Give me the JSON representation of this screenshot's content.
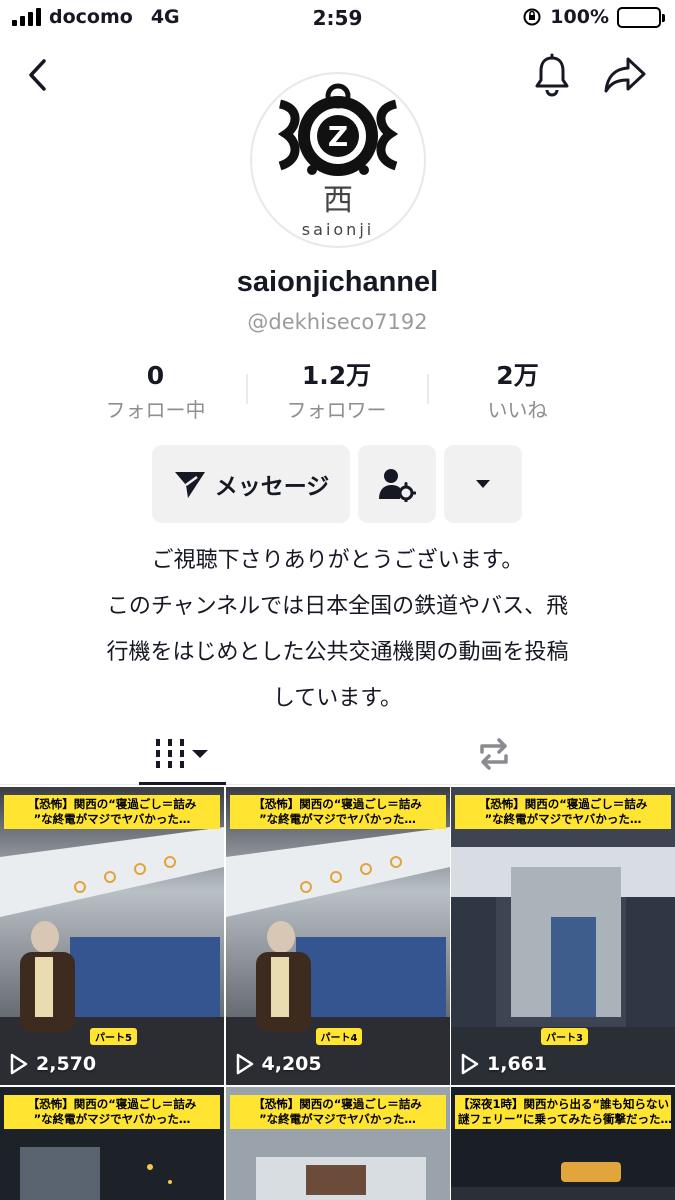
{
  "status_bar": {
    "carrier": "docomo",
    "network": "4G",
    "time": "2:59",
    "battery": "100%"
  },
  "profile": {
    "avatar_text": "saionji",
    "avatar_kanji": "西",
    "avatar_letter": "Z",
    "username": "saionjichannel",
    "handle": "@dekhiseco7192"
  },
  "stats": [
    {
      "value": "0",
      "label": "フォロー中"
    },
    {
      "value": "1.2万",
      "label": "フォロワー"
    },
    {
      "value": "2万",
      "label": "いいね"
    }
  ],
  "actions": {
    "message_label": "メッセージ"
  },
  "bio": {
    "line1": "ご視聴下さりありがとうございます。",
    "line2": "このチャンネルでは日本全国の鉄道やバス、飛",
    "line3": "行機をはじめとした公共交通機関の動画を投稿",
    "line4": "しています。"
  },
  "videos": [
    {
      "caption1": "【恐怖】関西の“寝過ごし＝詰み",
      "caption2": "”な終電がマジでヤバかった…",
      "views": "2,570",
      "part": "パート5"
    },
    {
      "caption1": "【恐怖】関西の“寝過ごし＝詰み",
      "caption2": "”な終電がマジでヤバかった…",
      "views": "4,205",
      "part": "パート4"
    },
    {
      "caption1": "【恐怖】関西の“寝過ごし＝詰み",
      "caption2": "”な終電がマジでヤバかった…",
      "views": "1,661",
      "part": "パート3"
    },
    {
      "caption1": "【恐怖】関西の“寝過ごし＝詰み",
      "caption2": "”な終電がマジでヤバかった…"
    },
    {
      "caption1": "【恐怖】関西の“寝過ごし＝詰み",
      "caption2": "”な終電がマジでヤバかった…"
    },
    {
      "caption1": "【深夜1時】関西から出る“誰も知らない",
      "caption2": "謎フェリー”に乗ってみたら衝撃だった…"
    }
  ],
  "colors": {
    "caption_bg": "#ffe531",
    "text_primary": "#161823",
    "text_secondary": "#8f8f8f"
  }
}
